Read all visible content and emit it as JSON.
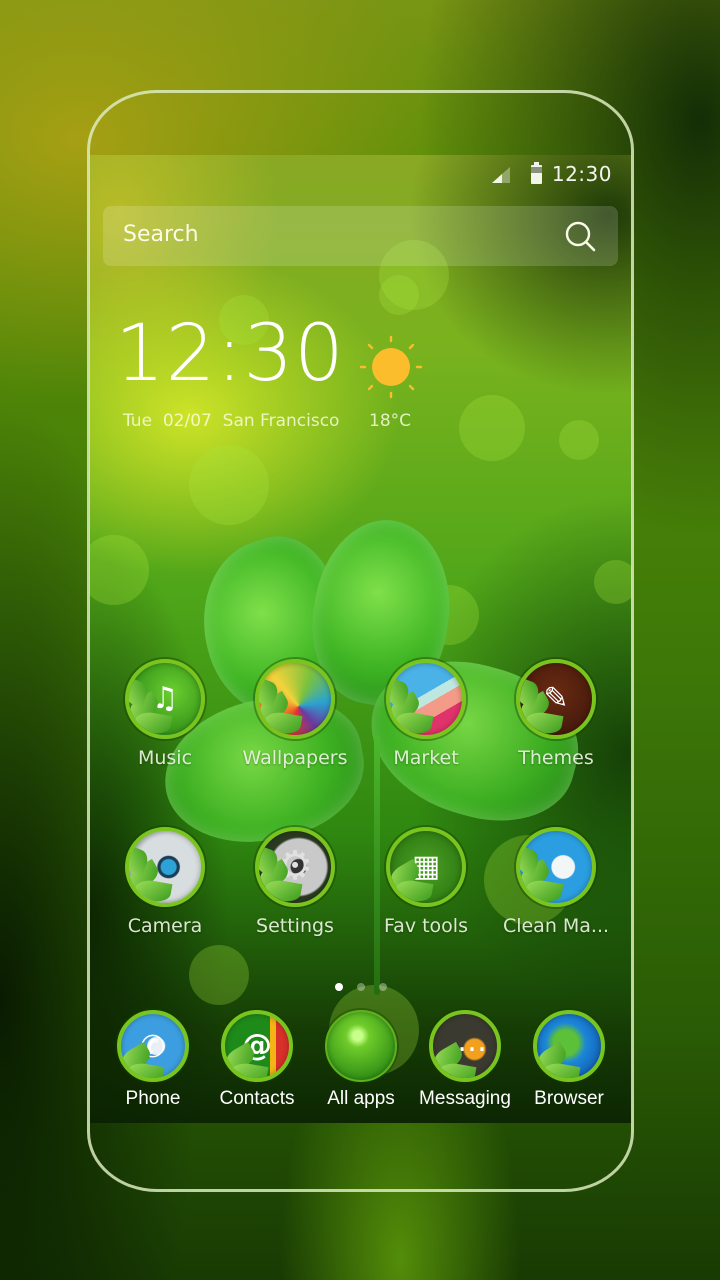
{
  "status_bar": {
    "time": "12:30",
    "signal_icon": "cell-signal-icon",
    "battery_icon": "battery-icon"
  },
  "search": {
    "placeholder": "Search",
    "icon": "search-icon"
  },
  "clock_widget": {
    "time": "12:30",
    "day": "Tue",
    "date": "02/07",
    "city": "San Francisco",
    "weather_icon": "sun-icon",
    "temperature": "18°C"
  },
  "apps": [
    {
      "label": "Music",
      "icon": "music-icon",
      "glyph": "♫"
    },
    {
      "label": "Wallpapers",
      "icon": "wallpapers-icon",
      "glyph": ""
    },
    {
      "label": "Market",
      "icon": "market-icon",
      "glyph": ""
    },
    {
      "label": "Themes",
      "icon": "themes-icon",
      "glyph": "✎"
    },
    {
      "label": "Camera",
      "icon": "camera-icon",
      "glyph": ""
    },
    {
      "label": "Settings",
      "icon": "settings-icon",
      "glyph": "⚙"
    },
    {
      "label": "Fav tools",
      "icon": "fav-tools-icon",
      "glyph": "▦"
    },
    {
      "label": "Clean Ma...",
      "icon": "clean-master-icon",
      "glyph": ""
    }
  ],
  "page_indicator": {
    "pages": 3,
    "current": 1
  },
  "dock": [
    {
      "label": "Phone",
      "icon": "phone-icon",
      "glyph": "✆"
    },
    {
      "label": "Contacts",
      "icon": "contacts-icon",
      "glyph": "@"
    },
    {
      "label": "All apps",
      "icon": "all-apps-icon",
      "glyph": ""
    },
    {
      "label": "Messaging",
      "icon": "messaging-icon",
      "glyph": "…"
    },
    {
      "label": "Browser",
      "icon": "browser-icon",
      "glyph": ""
    }
  ],
  "colors": {
    "frame": "#dcebbe",
    "icon_ring": "#79c51e",
    "sun": "#fbbd2c"
  }
}
